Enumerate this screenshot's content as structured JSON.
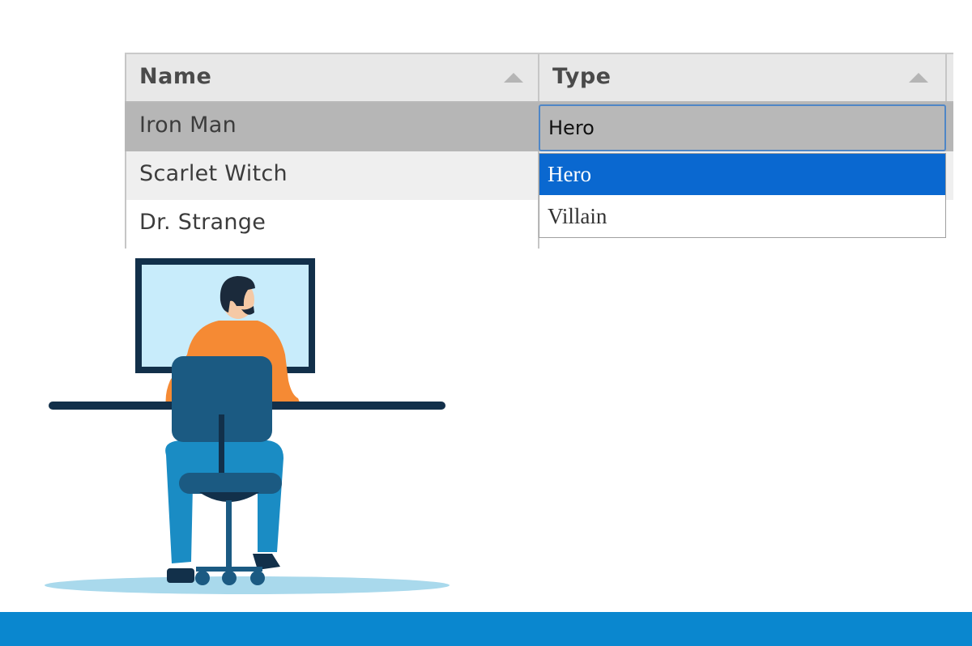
{
  "grid": {
    "columns": [
      {
        "label": "Name",
        "sort": "ascending"
      },
      {
        "label": "Type",
        "sort": "ascending"
      }
    ],
    "rows": [
      {
        "name": "Iron Man",
        "type": "Hero",
        "selected": true,
        "editing": true
      },
      {
        "name": "Scarlet Witch",
        "type": ""
      },
      {
        "name": "Dr. Strange",
        "type": ""
      }
    ],
    "editor": {
      "value": "Hero",
      "options": [
        "Hero",
        "Villain"
      ],
      "highlighted_index": 0
    }
  },
  "colors": {
    "header_bg": "#e8e8e8",
    "selected_row_bg": "#b6b6b6",
    "alt_row_bg": "#efefef",
    "option_highlight": "#0a68d0",
    "editor_border": "#4f86c6",
    "bottom_band": "#0a87cf"
  },
  "icons": {
    "sort": "triangle-up-icon"
  }
}
